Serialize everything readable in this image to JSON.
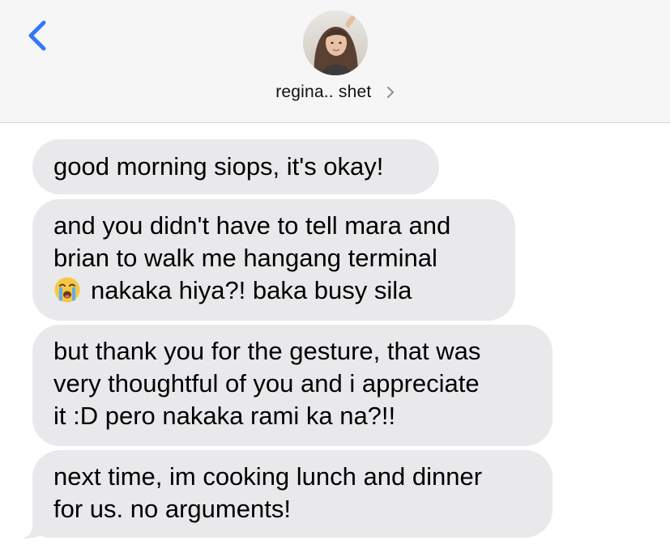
{
  "header": {
    "back_icon": "chevron-left-icon",
    "contact_name": "regina.. shet",
    "accent_color": "#3478f6"
  },
  "messages": [
    {
      "lines": [
        "good morning siops, it's okay!"
      ]
    },
    {
      "lines": [
        "and you didn't have to tell mara and",
        "brian to walk me hangang terminal",
        "nakaka hiya?! baka busy sila"
      ],
      "emoji": "loudly-crying-face-icon"
    },
    {
      "lines": [
        "but thank you for the gesture, that was",
        "very thoughtful of you and i appreciate",
        "it :D pero nakaka rami ka na?!!"
      ]
    },
    {
      "lines": [
        "next time, im cooking lunch and dinner",
        "for us. no arguments!"
      ]
    }
  ],
  "colors": {
    "bubble_gray": "#e9e9eb",
    "header_bg": "#f6f6f6"
  }
}
